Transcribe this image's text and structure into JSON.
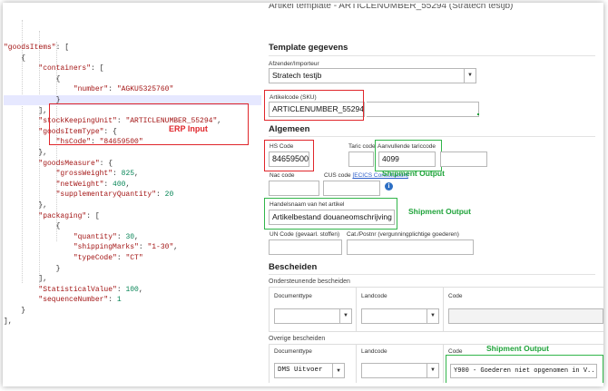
{
  "json_lines": [
    "\"goodsItems\": [",
    "    {",
    "        \"containers\": [",
    "            {",
    "                \"number\": \"AGKU5325760\"",
    "            }",
    "        ],",
    "        \"stockKeepingUnit\": \"ARTICLENUMBER_55294\",",
    "        \"goodsItemType\": {",
    "            \"hsCode\": \"84659500\"",
    "        },",
    "        \"goodsMeasure\": {",
    "            \"grossWeight\": 825,",
    "            \"netWeight\": 400,",
    "            \"supplementaryQuantity\": 20",
    "        },",
    "        \"packaging\": [",
    "            {",
    "                \"quantity\": 30,",
    "                \"shippingMarks\": \"1-30\",",
    "                \"typeCode\": \"CT\"",
    "            }",
    "        ],",
    "        \"StatisticalValue\": 100,",
    "        \"sequenceNumber\": 1",
    "    }",
    "],"
  ],
  "erp_label": "ERP Input",
  "form": {
    "title": "Artikel template - ARTICLENUMBER_55294 (Stratech testjb)",
    "section_template": "Template gegevens",
    "afzender_label": "Afzender/Importeur",
    "afzender_value": "Stratech testjb",
    "artikelcode_label": "Artikelcode (SKU)",
    "artikelcode_value": "ARTICLENUMBER_55294",
    "section_algemeen": "Algemeen",
    "hs_label": "HS Code",
    "hs_value": "84659500",
    "taric_label": "Taric code",
    "taric_value": "",
    "aanvullende_label": "Aanvullende tariccode",
    "aanvullende_value": "4099",
    "nac_label": "Nac code",
    "cus_label": "CUS code",
    "cus_link": "[ECICS Consultation]",
    "handelsnaam_label": "Handelsnaam van het artikel",
    "handelsnaam_value": "Artikelbestand douaneomschrijving",
    "un_label": "UN Code (gevaarl. stoffen)",
    "cat_label": "Cat./Postnr (vergunningplichtige goederen)",
    "section_bescheiden": "Bescheiden",
    "ondersteunende": "Ondersteunende bescheiden",
    "col_documenttype": "Documenttype",
    "col_landcode": "Landcode",
    "col_code": "Code",
    "overige": "Overige bescheiden",
    "doc_value": "DMS Uitvoer",
    "code_value": "Y900 - Goederen niet opgenomen in V..."
  },
  "shipment_output": "Shipment Output",
  "colors": {
    "red": "#e0262b",
    "green": "#31b54a",
    "link": "#2a5cc9"
  }
}
